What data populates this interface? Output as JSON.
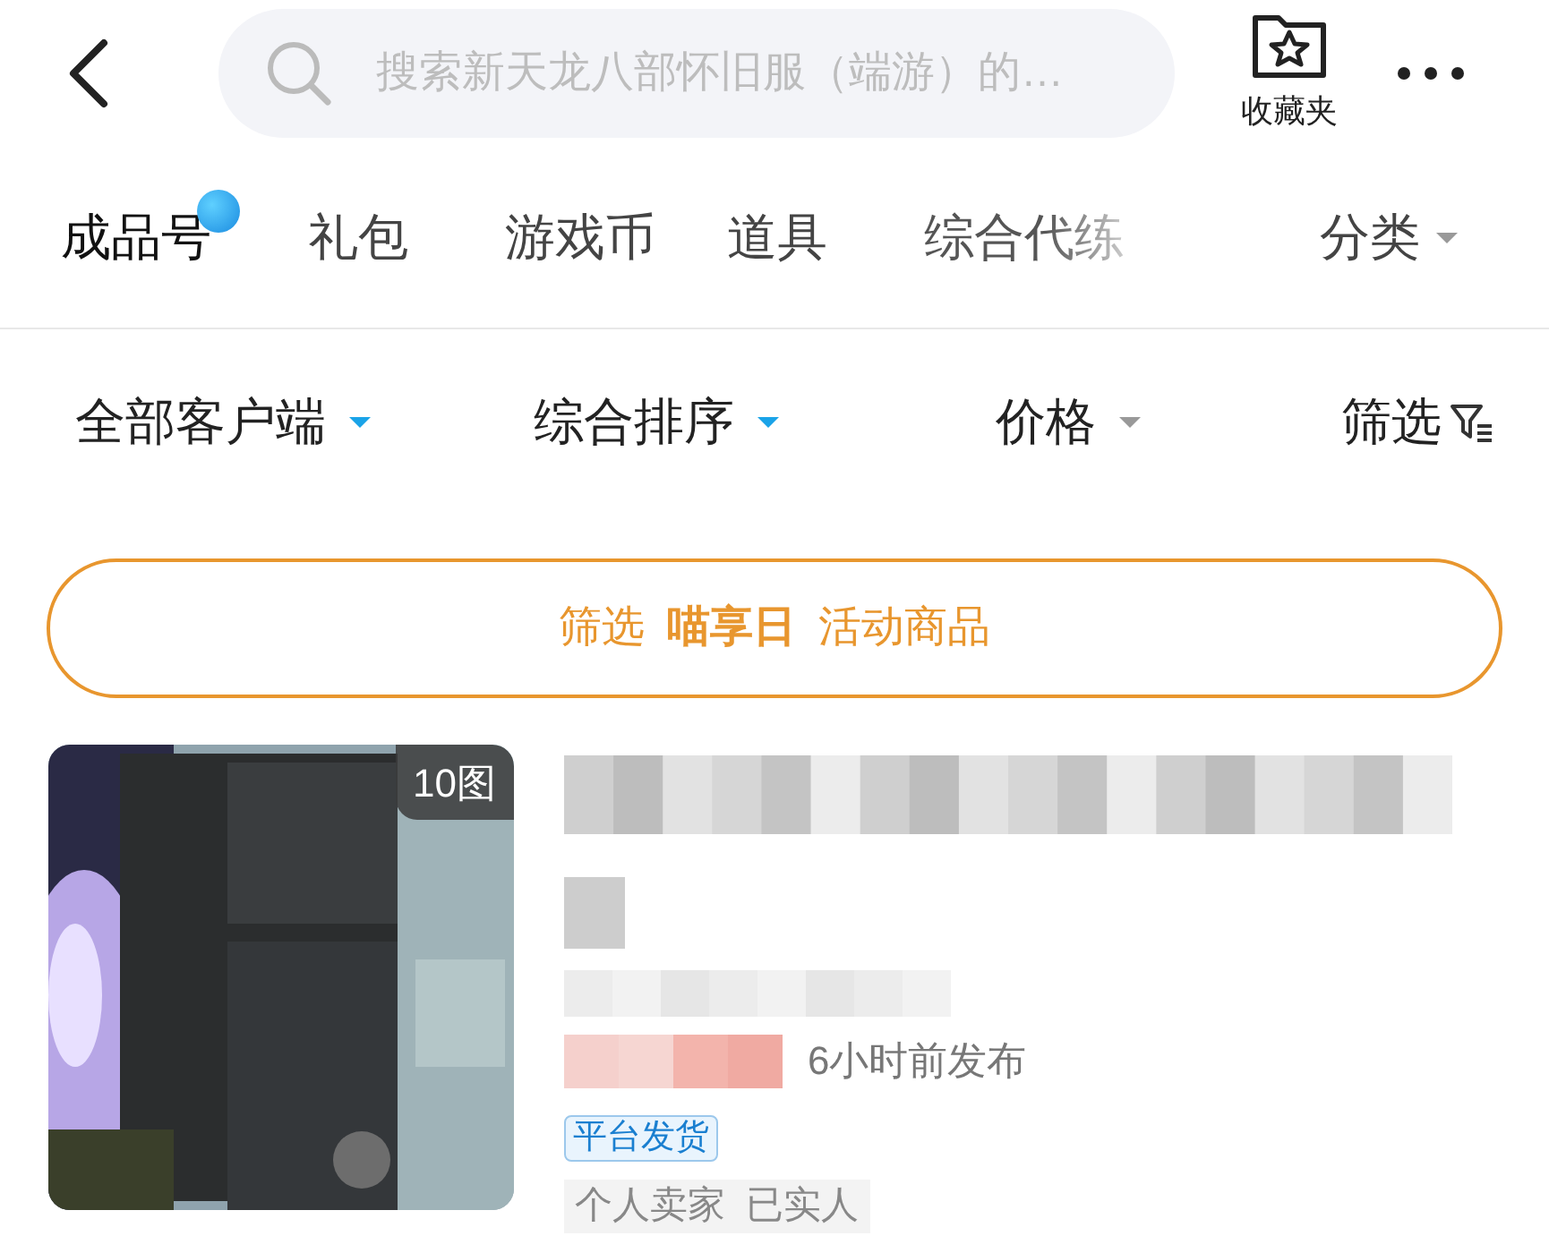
{
  "header": {
    "search": {
      "placeholder": "搜索新天龙八部怀旧服（端游）的…"
    },
    "favorites_label": "收藏夹"
  },
  "tabs": [
    {
      "label": "成品号",
      "selected": true,
      "dot": true
    },
    {
      "label": "礼包",
      "selected": false,
      "dot": false
    },
    {
      "label": "游戏币",
      "selected": false,
      "dot": false
    },
    {
      "label": "道具",
      "selected": false,
      "dot": false
    },
    {
      "label": "综合代练",
      "selected": false,
      "dot": false
    }
  ],
  "category_tab": "分类",
  "filters": [
    {
      "label": "全部客户端",
      "active": true
    },
    {
      "label": "综合排序",
      "active": true
    },
    {
      "label": "价格",
      "active": false
    }
  ],
  "filter_button": "筛选",
  "banner": "筛选 **喵享日** 活动商品",
  "listing": {
    "image_count": "10图",
    "posted": "6小时前发布",
    "tags": [
      {
        "label": "平台发货",
        "kind": "platform"
      },
      {
        "label": "个人卖家  已实人",
        "kind": "seller"
      }
    ]
  }
}
